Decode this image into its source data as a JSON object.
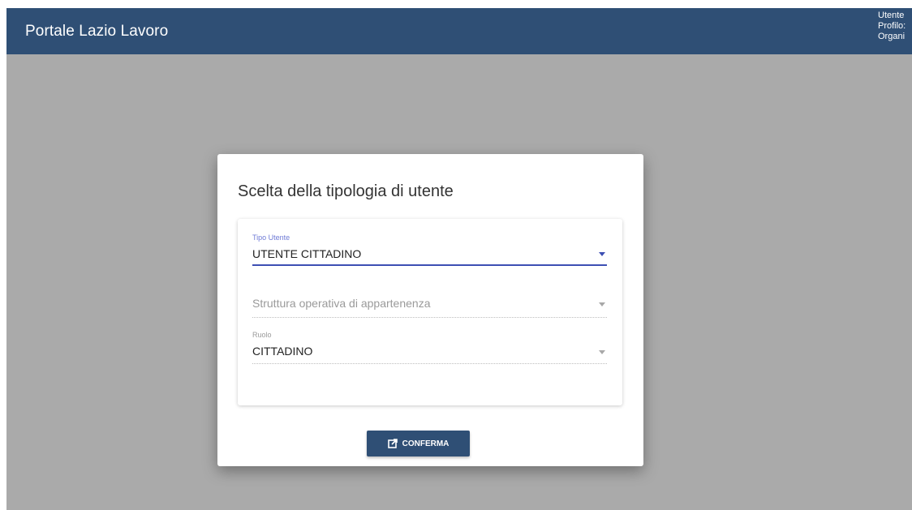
{
  "header": {
    "title": "Portale Lazio Lavoro",
    "user_info": [
      "Utente",
      "Profilo:",
      "Organi"
    ]
  },
  "dialog": {
    "title": "Scelta della tipologia di utente",
    "fields": {
      "tipo_utente": {
        "label": "Tipo Utente",
        "value": "UTENTE CITTADINO"
      },
      "struttura": {
        "placeholder": "Struttura operativa di appartenenza"
      },
      "ruolo": {
        "label": "Ruolo",
        "value": "CITTADINO"
      }
    },
    "confirm_label": "CONFERMA",
    "confirm_icon": "external-link-icon"
  },
  "colors": {
    "header_bg": "#2f4f75",
    "overlay_bg": "#aaaaaa",
    "accent": "#3d4fb3",
    "button_bg": "#2f4f75"
  }
}
